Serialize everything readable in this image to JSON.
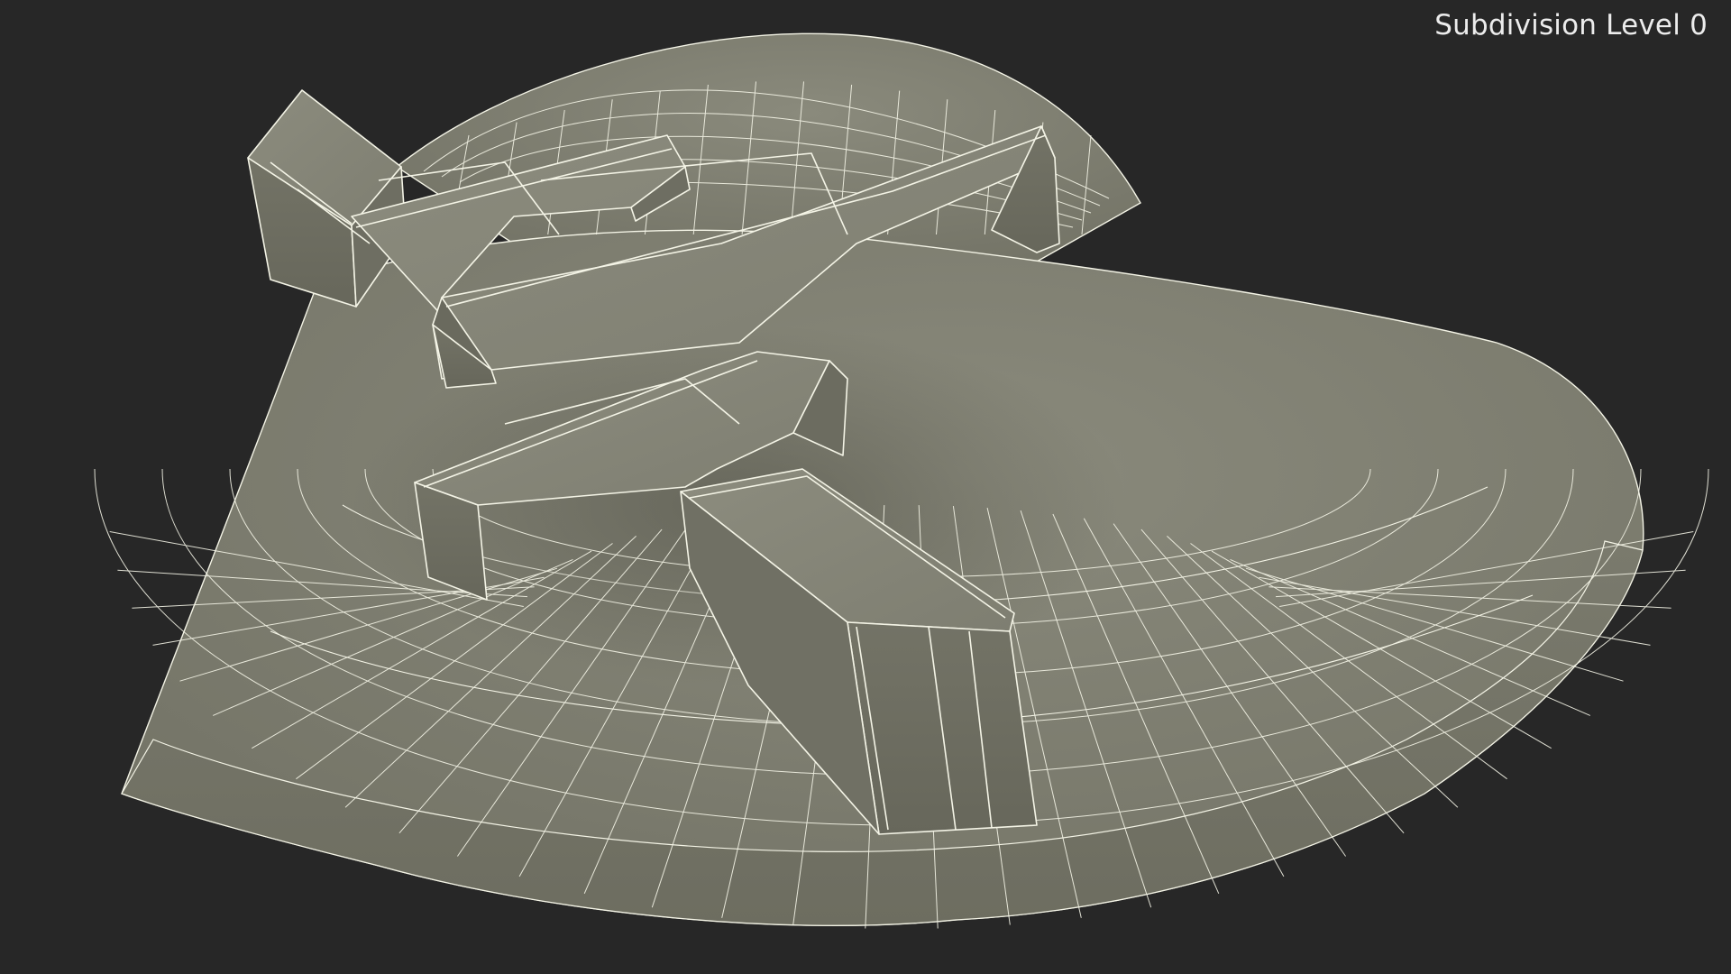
{
  "overlay": {
    "label": "Subdivision Level 0"
  },
  "colors": {
    "background": "#272727",
    "surface_light": "#8a8a7c",
    "surface_mid": "#7b7b6e",
    "surface_dark": "#666659",
    "wireframe": "#f4f4e6"
  }
}
